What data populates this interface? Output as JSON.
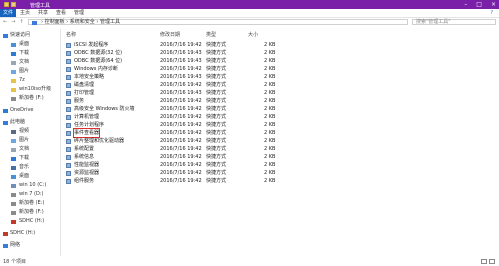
{
  "window": {
    "title": "管理工具"
  },
  "ribbon": {
    "file_tab": "文件",
    "tabs": [
      "主页",
      "共享",
      "查看",
      "管理"
    ],
    "help": "?"
  },
  "address": {
    "back": "←",
    "forward": "→",
    "up": "↑",
    "path": "› 控制面板 › 系统和安全 › 管理工具",
    "search_placeholder": "搜索\"管理工具\""
  },
  "sidebar": {
    "items": [
      {
        "label": "快速访问"
      },
      {
        "label": "桌面"
      },
      {
        "label": "下载"
      },
      {
        "label": "文档"
      },
      {
        "label": "图片"
      },
      {
        "label": "7z"
      },
      {
        "label": "win10iso升级"
      },
      {
        "label": "新加卷 (F:)"
      },
      {
        "label": "OneDrive"
      },
      {
        "label": "此电脑"
      },
      {
        "label": "视频"
      },
      {
        "label": "图片"
      },
      {
        "label": "文档"
      },
      {
        "label": "下载"
      },
      {
        "label": "音乐"
      },
      {
        "label": "桌面"
      },
      {
        "label": "win 10 (C:)"
      },
      {
        "label": "win 7 (D:)"
      },
      {
        "label": "新加卷 (E:)"
      },
      {
        "label": "新加卷 (F:)"
      },
      {
        "label": "SDHC (H:)"
      },
      {
        "label": "SDHC (H:)"
      },
      {
        "label": "网络"
      }
    ]
  },
  "columns": {
    "name": "名称",
    "date": "修改日期",
    "type": "类型",
    "size": "大小"
  },
  "files": [
    {
      "name": "iSCSI 发起程序",
      "date": "2016/7/16 19:42",
      "type": "快捷方式",
      "size": "2 KB"
    },
    {
      "name": "ODBC 数据源(32 位)",
      "date": "2016/7/16 19:43",
      "type": "快捷方式",
      "size": "2 KB"
    },
    {
      "name": "ODBC 数据源(64 位)",
      "date": "2016/7/16 19:43",
      "type": "快捷方式",
      "size": "2 KB"
    },
    {
      "name": "Windows 内存诊断",
      "date": "2016/7/16 19:42",
      "type": "快捷方式",
      "size": "2 KB"
    },
    {
      "name": "本地安全策略",
      "date": "2016/7/16 19:43",
      "type": "快捷方式",
      "size": "2 KB"
    },
    {
      "name": "磁盘清理",
      "date": "2016/7/16 19:42",
      "type": "快捷方式",
      "size": "2 KB"
    },
    {
      "name": "打印管理",
      "date": "2016/7/16 19:43",
      "type": "快捷方式",
      "size": "2 KB"
    },
    {
      "name": "服务",
      "date": "2016/7/16 19:42",
      "type": "快捷方式",
      "size": "2 KB"
    },
    {
      "name": "高级安全 Windows 防火墙",
      "date": "2016/7/16 19:42",
      "type": "快捷方式",
      "size": "2 KB"
    },
    {
      "name": "计算机管理",
      "date": "2016/7/16 19:42",
      "type": "快捷方式",
      "size": "2 KB"
    },
    {
      "name": "任务计划程序",
      "date": "2016/7/16 19:42",
      "type": "快捷方式",
      "size": "2 KB"
    },
    {
      "name": "事件查看器",
      "date": "2016/7/16 19:42",
      "type": "快捷方式",
      "size": "2 KB"
    },
    {
      "name": "碎片整理和优化驱动器",
      "date": "2016/7/16 19:42",
      "type": "快捷方式",
      "size": "2 KB"
    },
    {
      "name": "系统配置",
      "date": "2016/7/16 19:42",
      "type": "快捷方式",
      "size": "2 KB"
    },
    {
      "name": "系统信息",
      "date": "2016/7/16 19:42",
      "type": "快捷方式",
      "size": "2 KB"
    },
    {
      "name": "性能监视器",
      "date": "2016/7/16 19:42",
      "type": "快捷方式",
      "size": "2 KB"
    },
    {
      "name": "资源监视器",
      "date": "2016/7/16 19:42",
      "type": "快捷方式",
      "size": "2 KB"
    },
    {
      "name": "组件服务",
      "date": "2016/7/16 19:42",
      "type": "快捷方式",
      "size": "2 KB"
    }
  ],
  "status": {
    "count": "18 个项目"
  },
  "colors": {
    "titlebar": "#7a1fa8",
    "file_tab": "#1565c0",
    "selection_outline": "#e03030"
  }
}
